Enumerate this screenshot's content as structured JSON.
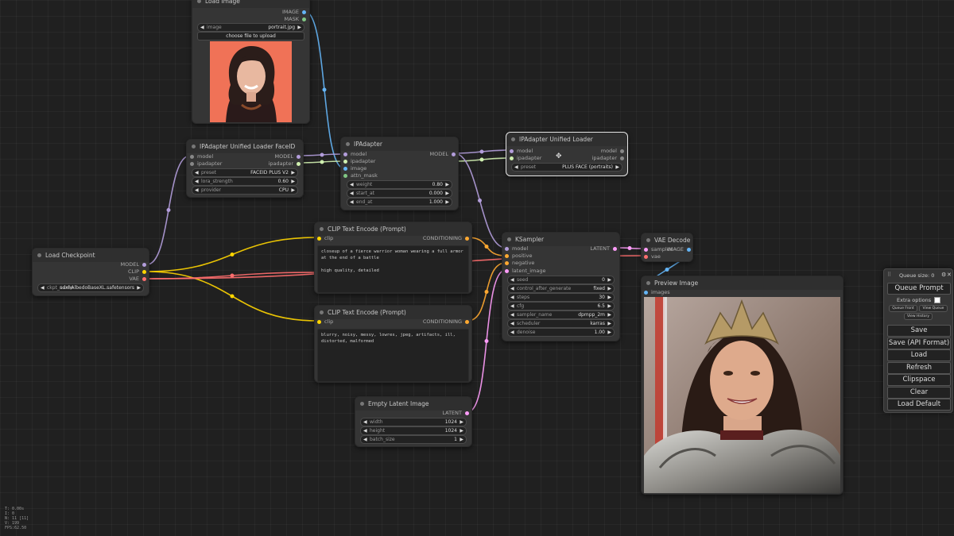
{
  "colors": {
    "model": "#b39ddb",
    "clip": "#ffd500",
    "vae": "#ff6e6e",
    "conditioning": "#ffa931",
    "latent": "#ff9cf9",
    "image": "#64b5f6",
    "ipadapter": "#d0f0b0",
    "mask": "#81c784"
  },
  "nodes": {
    "load_image": {
      "title": "Load Image",
      "outputs": [
        "IMAGE",
        "MASK"
      ],
      "image_widget": {
        "label": "image",
        "value": "portrait.jpg"
      },
      "upload_label": "choose file to upload"
    },
    "loader_faceid": {
      "title": "IPAdapter Unified Loader FaceID",
      "inputs": [
        "model",
        "ipadapter"
      ],
      "outputs": [
        "MODEL",
        "ipadapter"
      ],
      "widgets": [
        {
          "label": "preset",
          "value": "FACEID PLUS V2"
        },
        {
          "label": "lora_strength",
          "value": "0.60"
        },
        {
          "label": "provider",
          "value": "CPU"
        }
      ]
    },
    "ipadapter": {
      "title": "IPAdapter",
      "inputs": [
        "model",
        "ipadapter",
        "image",
        "attn_mask"
      ],
      "outputs": [
        "MODEL"
      ],
      "widgets": [
        {
          "label": "weight",
          "value": "0.80"
        },
        {
          "label": "start_at",
          "value": "0.000"
        },
        {
          "label": "end_at",
          "value": "1.000"
        }
      ]
    },
    "unified_loader": {
      "title": "IPAdapter Unified Loader",
      "inputs": [
        "model",
        "ipadapter"
      ],
      "outputs": [
        "model",
        "ipadapter"
      ],
      "widgets": [
        {
          "label": "preset",
          "value": "PLUS FACE (portraits)"
        }
      ]
    },
    "load_checkpoint": {
      "title": "Load Checkpoint",
      "outputs": [
        "MODEL",
        "CLIP",
        "VAE"
      ],
      "widgets": [
        {
          "label": "ckpt_name",
          "value": "sdxl\\AlbedoBaseXL.safetensors"
        }
      ]
    },
    "clip_pos": {
      "title": "CLIP Text Encode (Prompt)",
      "inputs": [
        "clip"
      ],
      "outputs": [
        "CONDITIONING"
      ],
      "text": "closeup of a fierce warrior woman wearing a full armor at the end of a battle\n\nhigh quality, detailed"
    },
    "clip_neg": {
      "title": "CLIP Text Encode (Prompt)",
      "inputs": [
        "clip"
      ],
      "outputs": [
        "CONDITIONING"
      ],
      "text": "blurry, noisy, messy, lowres, jpeg, artifacts, ill, distorted, malformed"
    },
    "empty_latent": {
      "title": "Empty Latent Image",
      "outputs": [
        "LATENT"
      ],
      "widgets": [
        {
          "label": "width",
          "value": "1024"
        },
        {
          "label": "height",
          "value": "1024"
        },
        {
          "label": "batch_size",
          "value": "1"
        }
      ]
    },
    "ksampler": {
      "title": "KSampler",
      "inputs": [
        "model",
        "positive",
        "negative",
        "latent_image"
      ],
      "outputs": [
        "LATENT"
      ],
      "widgets": [
        {
          "label": "seed",
          "value": "0"
        },
        {
          "label": "control_after_generate",
          "value": "fixed"
        },
        {
          "label": "steps",
          "value": "30"
        },
        {
          "label": "cfg",
          "value": "6.5"
        },
        {
          "label": "sampler_name",
          "value": "dpmpp_2m"
        },
        {
          "label": "scheduler",
          "value": "karras"
        },
        {
          "label": "denoise",
          "value": "1.00"
        }
      ]
    },
    "vae_decode": {
      "title": "VAE Decode",
      "inputs": [
        "samples",
        "vae"
      ],
      "outputs": [
        "IMAGE"
      ]
    },
    "preview_image": {
      "title": "Preview Image",
      "inputs": [
        "images"
      ]
    }
  },
  "menu": {
    "queue_size": "Queue size: 0",
    "queue_prompt": "Queue Prompt",
    "extra_options": "Extra options",
    "small_buttons": [
      "Queue Front",
      "View Queue",
      "View History"
    ],
    "buttons": [
      "Save",
      "Save (API Format)",
      "Load",
      "Refresh",
      "Clipspace",
      "Clear",
      "Load Default"
    ]
  },
  "stats": [
    "T: 0.00s",
    "I: 0",
    "N: 11 [11]",
    "V: 199",
    "FPS:62.50"
  ]
}
